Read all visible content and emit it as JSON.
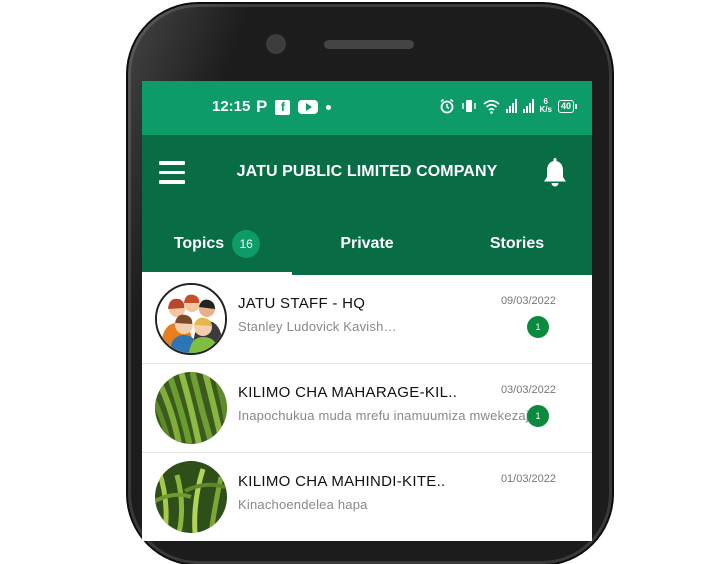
{
  "status_bar": {
    "time": "12:15",
    "left_icons": [
      "p-icon",
      "facebook-icon",
      "youtube-icon",
      "dot-icon"
    ],
    "right_icons": [
      "alarm-icon",
      "vibrate-icon",
      "wifi-icon",
      "signal-icon",
      "signal-icon",
      "network-speed-icon",
      "battery-icon"
    ],
    "network_speed_value": "6",
    "network_speed_unit": "K/s",
    "battery": "40"
  },
  "app_bar": {
    "title": "JATU PUBLIC LIMITED COMPANY"
  },
  "tabs": [
    {
      "label": "Topics",
      "badge": "16",
      "active": true
    },
    {
      "label": "Private",
      "active": false
    },
    {
      "label": "Stories",
      "active": false
    }
  ],
  "conversations": [
    {
      "title": "JATU STAFF - HQ",
      "subtitle": "Stanley Ludovick Kavish…",
      "date": "09/03/2022",
      "unread": "1"
    },
    {
      "title": "KILIMO CHA MAHARAGE-KIL..",
      "subtitle": "Inapochukua muda mrefu inamuumiza mwekezaji.",
      "date": "03/03/2022",
      "unread": "1"
    },
    {
      "title": "KILIMO CHA MAHINDI-KITE..",
      "subtitle": "Kinachoendelea hapa",
      "date": "01/03/2022"
    }
  ],
  "colors": {
    "status_bar": "#0d9b68",
    "app_bar": "#086d45",
    "unread_badge": "#0a8a3e"
  }
}
